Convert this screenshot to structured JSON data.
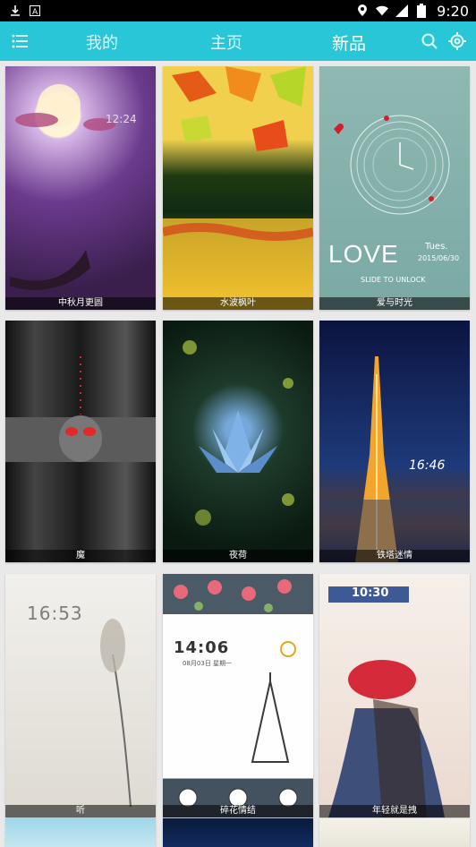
{
  "statusbar": {
    "time": "9:20",
    "icons": [
      "download-icon",
      "app-icon",
      "location-icon",
      "wifi-icon",
      "signal-icon",
      "battery-icon"
    ]
  },
  "topbar": {
    "tabs": [
      {
        "label": "我的"
      },
      {
        "label": "主页"
      },
      {
        "label": "新品"
      }
    ],
    "active_tab": "新品",
    "accent_color": "#29c6d8"
  },
  "themes": [
    {
      "title": "中秋月更圆",
      "overlay_time": "12:24"
    },
    {
      "title": "水波枫叶"
    },
    {
      "title": "爱与时光",
      "overlay_text": "LOVE",
      "overlay_sub": "SLIDE TO UNLOCK",
      "overlay_day": "Tues.",
      "overlay_date": "2015/06/30"
    },
    {
      "title": "魔"
    },
    {
      "title": "夜荷"
    },
    {
      "title": "铁塔迷情",
      "overlay_time": "16:46"
    },
    {
      "title": "听",
      "overlay_time": "16:53"
    },
    {
      "title": "碎花情结",
      "overlay_time": "14:06",
      "overlay_date": "08月03日 星期一"
    },
    {
      "title": "年轻就是拽",
      "overlay_time": "10:30"
    }
  ]
}
